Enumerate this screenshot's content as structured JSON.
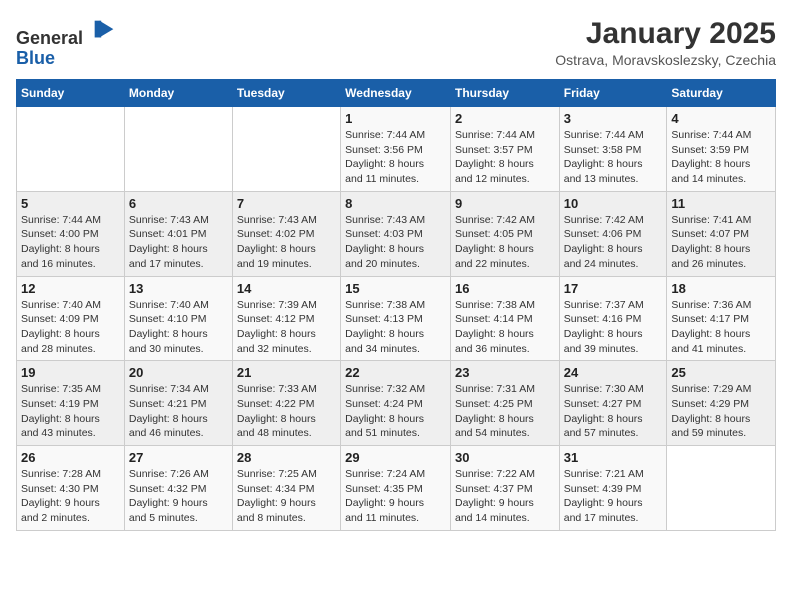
{
  "header": {
    "logo_general": "General",
    "logo_blue": "Blue",
    "title": "January 2025",
    "subtitle": "Ostrava, Moravskoslezsky, Czechia"
  },
  "weekdays": [
    "Sunday",
    "Monday",
    "Tuesday",
    "Wednesday",
    "Thursday",
    "Friday",
    "Saturday"
  ],
  "weeks": [
    [
      {
        "day": "",
        "info": ""
      },
      {
        "day": "",
        "info": ""
      },
      {
        "day": "",
        "info": ""
      },
      {
        "day": "1",
        "info": "Sunrise: 7:44 AM\nSunset: 3:56 PM\nDaylight: 8 hours\nand 11 minutes."
      },
      {
        "day": "2",
        "info": "Sunrise: 7:44 AM\nSunset: 3:57 PM\nDaylight: 8 hours\nand 12 minutes."
      },
      {
        "day": "3",
        "info": "Sunrise: 7:44 AM\nSunset: 3:58 PM\nDaylight: 8 hours\nand 13 minutes."
      },
      {
        "day": "4",
        "info": "Sunrise: 7:44 AM\nSunset: 3:59 PM\nDaylight: 8 hours\nand 14 minutes."
      }
    ],
    [
      {
        "day": "5",
        "info": "Sunrise: 7:44 AM\nSunset: 4:00 PM\nDaylight: 8 hours\nand 16 minutes."
      },
      {
        "day": "6",
        "info": "Sunrise: 7:43 AM\nSunset: 4:01 PM\nDaylight: 8 hours\nand 17 minutes."
      },
      {
        "day": "7",
        "info": "Sunrise: 7:43 AM\nSunset: 4:02 PM\nDaylight: 8 hours\nand 19 minutes."
      },
      {
        "day": "8",
        "info": "Sunrise: 7:43 AM\nSunset: 4:03 PM\nDaylight: 8 hours\nand 20 minutes."
      },
      {
        "day": "9",
        "info": "Sunrise: 7:42 AM\nSunset: 4:05 PM\nDaylight: 8 hours\nand 22 minutes."
      },
      {
        "day": "10",
        "info": "Sunrise: 7:42 AM\nSunset: 4:06 PM\nDaylight: 8 hours\nand 24 minutes."
      },
      {
        "day": "11",
        "info": "Sunrise: 7:41 AM\nSunset: 4:07 PM\nDaylight: 8 hours\nand 26 minutes."
      }
    ],
    [
      {
        "day": "12",
        "info": "Sunrise: 7:40 AM\nSunset: 4:09 PM\nDaylight: 8 hours\nand 28 minutes."
      },
      {
        "day": "13",
        "info": "Sunrise: 7:40 AM\nSunset: 4:10 PM\nDaylight: 8 hours\nand 30 minutes."
      },
      {
        "day": "14",
        "info": "Sunrise: 7:39 AM\nSunset: 4:12 PM\nDaylight: 8 hours\nand 32 minutes."
      },
      {
        "day": "15",
        "info": "Sunrise: 7:38 AM\nSunset: 4:13 PM\nDaylight: 8 hours\nand 34 minutes."
      },
      {
        "day": "16",
        "info": "Sunrise: 7:38 AM\nSunset: 4:14 PM\nDaylight: 8 hours\nand 36 minutes."
      },
      {
        "day": "17",
        "info": "Sunrise: 7:37 AM\nSunset: 4:16 PM\nDaylight: 8 hours\nand 39 minutes."
      },
      {
        "day": "18",
        "info": "Sunrise: 7:36 AM\nSunset: 4:17 PM\nDaylight: 8 hours\nand 41 minutes."
      }
    ],
    [
      {
        "day": "19",
        "info": "Sunrise: 7:35 AM\nSunset: 4:19 PM\nDaylight: 8 hours\nand 43 minutes."
      },
      {
        "day": "20",
        "info": "Sunrise: 7:34 AM\nSunset: 4:21 PM\nDaylight: 8 hours\nand 46 minutes."
      },
      {
        "day": "21",
        "info": "Sunrise: 7:33 AM\nSunset: 4:22 PM\nDaylight: 8 hours\nand 48 minutes."
      },
      {
        "day": "22",
        "info": "Sunrise: 7:32 AM\nSunset: 4:24 PM\nDaylight: 8 hours\nand 51 minutes."
      },
      {
        "day": "23",
        "info": "Sunrise: 7:31 AM\nSunset: 4:25 PM\nDaylight: 8 hours\nand 54 minutes."
      },
      {
        "day": "24",
        "info": "Sunrise: 7:30 AM\nSunset: 4:27 PM\nDaylight: 8 hours\nand 57 minutes."
      },
      {
        "day": "25",
        "info": "Sunrise: 7:29 AM\nSunset: 4:29 PM\nDaylight: 8 hours\nand 59 minutes."
      }
    ],
    [
      {
        "day": "26",
        "info": "Sunrise: 7:28 AM\nSunset: 4:30 PM\nDaylight: 9 hours\nand 2 minutes."
      },
      {
        "day": "27",
        "info": "Sunrise: 7:26 AM\nSunset: 4:32 PM\nDaylight: 9 hours\nand 5 minutes."
      },
      {
        "day": "28",
        "info": "Sunrise: 7:25 AM\nSunset: 4:34 PM\nDaylight: 9 hours\nand 8 minutes."
      },
      {
        "day": "29",
        "info": "Sunrise: 7:24 AM\nSunset: 4:35 PM\nDaylight: 9 hours\nand 11 minutes."
      },
      {
        "day": "30",
        "info": "Sunrise: 7:22 AM\nSunset: 4:37 PM\nDaylight: 9 hours\nand 14 minutes."
      },
      {
        "day": "31",
        "info": "Sunrise: 7:21 AM\nSunset: 4:39 PM\nDaylight: 9 hours\nand 17 minutes."
      },
      {
        "day": "",
        "info": ""
      }
    ]
  ]
}
